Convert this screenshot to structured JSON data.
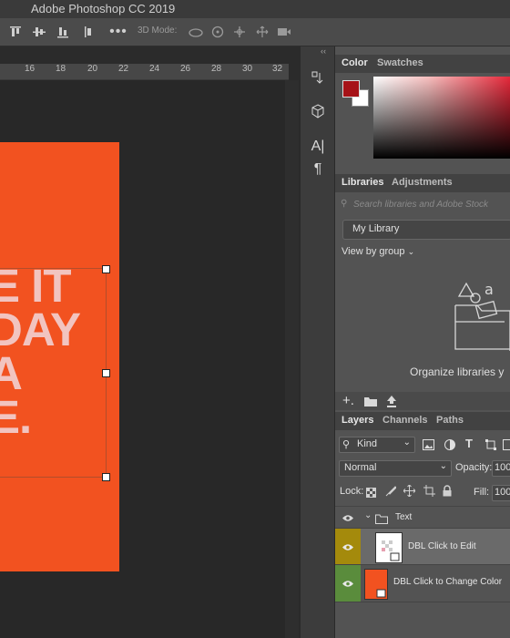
{
  "app": {
    "title": "Adobe Photoshop CC 2019"
  },
  "options_bar": {
    "mode_label": "3D Mode:"
  },
  "ruler": {
    "ticks": [
      "16",
      "18",
      "20",
      "22",
      "24",
      "26",
      "28",
      "30",
      "32"
    ]
  },
  "artboard": {
    "text_lines": [
      "E IT",
      "DAY",
      "A",
      "E."
    ]
  },
  "color_panel": {
    "tabs": [
      "Color",
      "Swatches"
    ],
    "foreground_color": "#a61217",
    "background_color": "#ffffff"
  },
  "libraries_panel": {
    "tabs": [
      "Libraries",
      "Adjustments"
    ],
    "search_placeholder": "Search libraries and Adobe Stock",
    "library_select": "My Library",
    "view_by": "View by group",
    "message": "Organize libraries y"
  },
  "layers_panel": {
    "tabs": [
      "Layers",
      "Channels",
      "Paths"
    ],
    "filter_kind": "Kind",
    "blend_mode": "Normal",
    "opacity_label": "Opacity:",
    "opacity_value": "100",
    "lock_label": "Lock:",
    "fill_label": "Fill:",
    "fill_value": "100",
    "layers": [
      {
        "name": "Text",
        "type": "group"
      },
      {
        "name": "DBL Click to Edit",
        "type": "smart",
        "eye_color": "#a48a0c"
      },
      {
        "name": "DBL Click to Change Color",
        "type": "fill",
        "eye_color": "#5a8c3c"
      }
    ]
  }
}
